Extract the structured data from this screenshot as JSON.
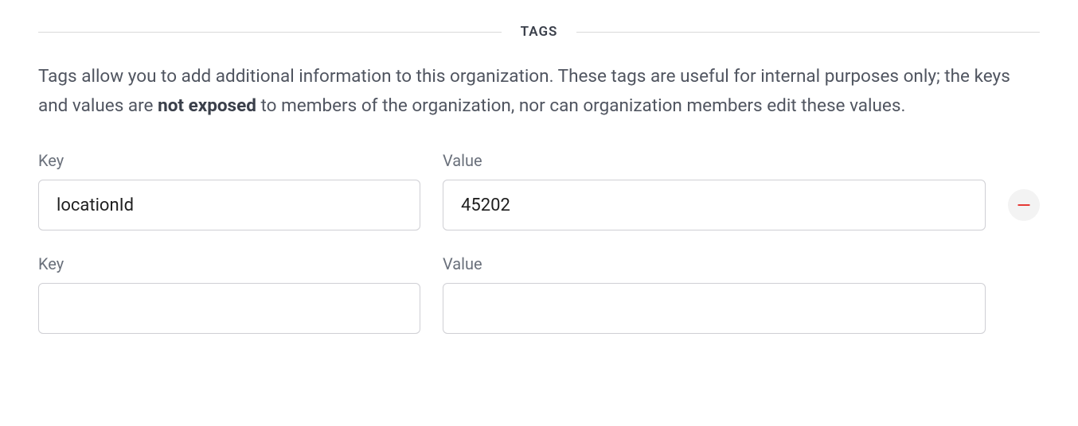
{
  "section": {
    "heading": "TAGS",
    "description_pre": "Tags allow you to add additional information to this organization. These tags are useful for internal purposes only; the keys and values are ",
    "description_strong": "not exposed",
    "description_post": " to members of the organization, nor can organization members edit these values."
  },
  "labels": {
    "key": "Key",
    "value": "Value"
  },
  "rows": [
    {
      "key": "locationId",
      "value": "45202"
    },
    {
      "key": "",
      "value": ""
    }
  ]
}
